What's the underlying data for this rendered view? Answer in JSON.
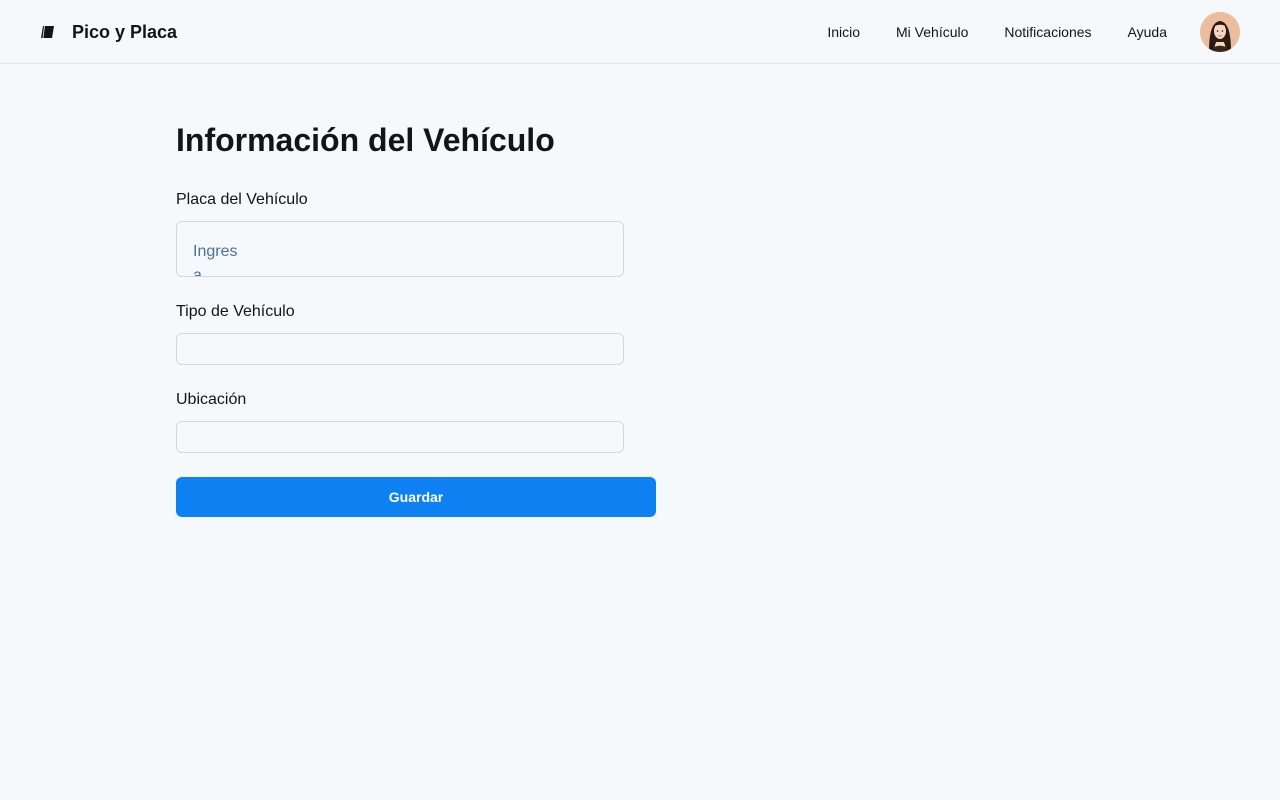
{
  "header": {
    "brand_name": "Pico y Placa",
    "brand_icon": "logo-icon",
    "nav": [
      {
        "label": "Inicio"
      },
      {
        "label": "Mi Vehículo"
      },
      {
        "label": "Notificaciones"
      },
      {
        "label": "Ayuda"
      }
    ],
    "avatar_icon": "user-avatar"
  },
  "form": {
    "title": "Información del Vehículo",
    "plate": {
      "label": "Placa del Vehículo",
      "value": "",
      "placeholder": "Ingresa laplaca"
    },
    "vehicle_type": {
      "label": "Tipo de Vehículo",
      "value": ""
    },
    "location": {
      "label": "Ubicación",
      "value": ""
    },
    "save_label": "Guardar"
  },
  "colors": {
    "background": "#f5f9fc",
    "primary": "#0d80f2",
    "text": "#111418",
    "placeholder": "#4a7399",
    "border": "#d0d7de"
  }
}
